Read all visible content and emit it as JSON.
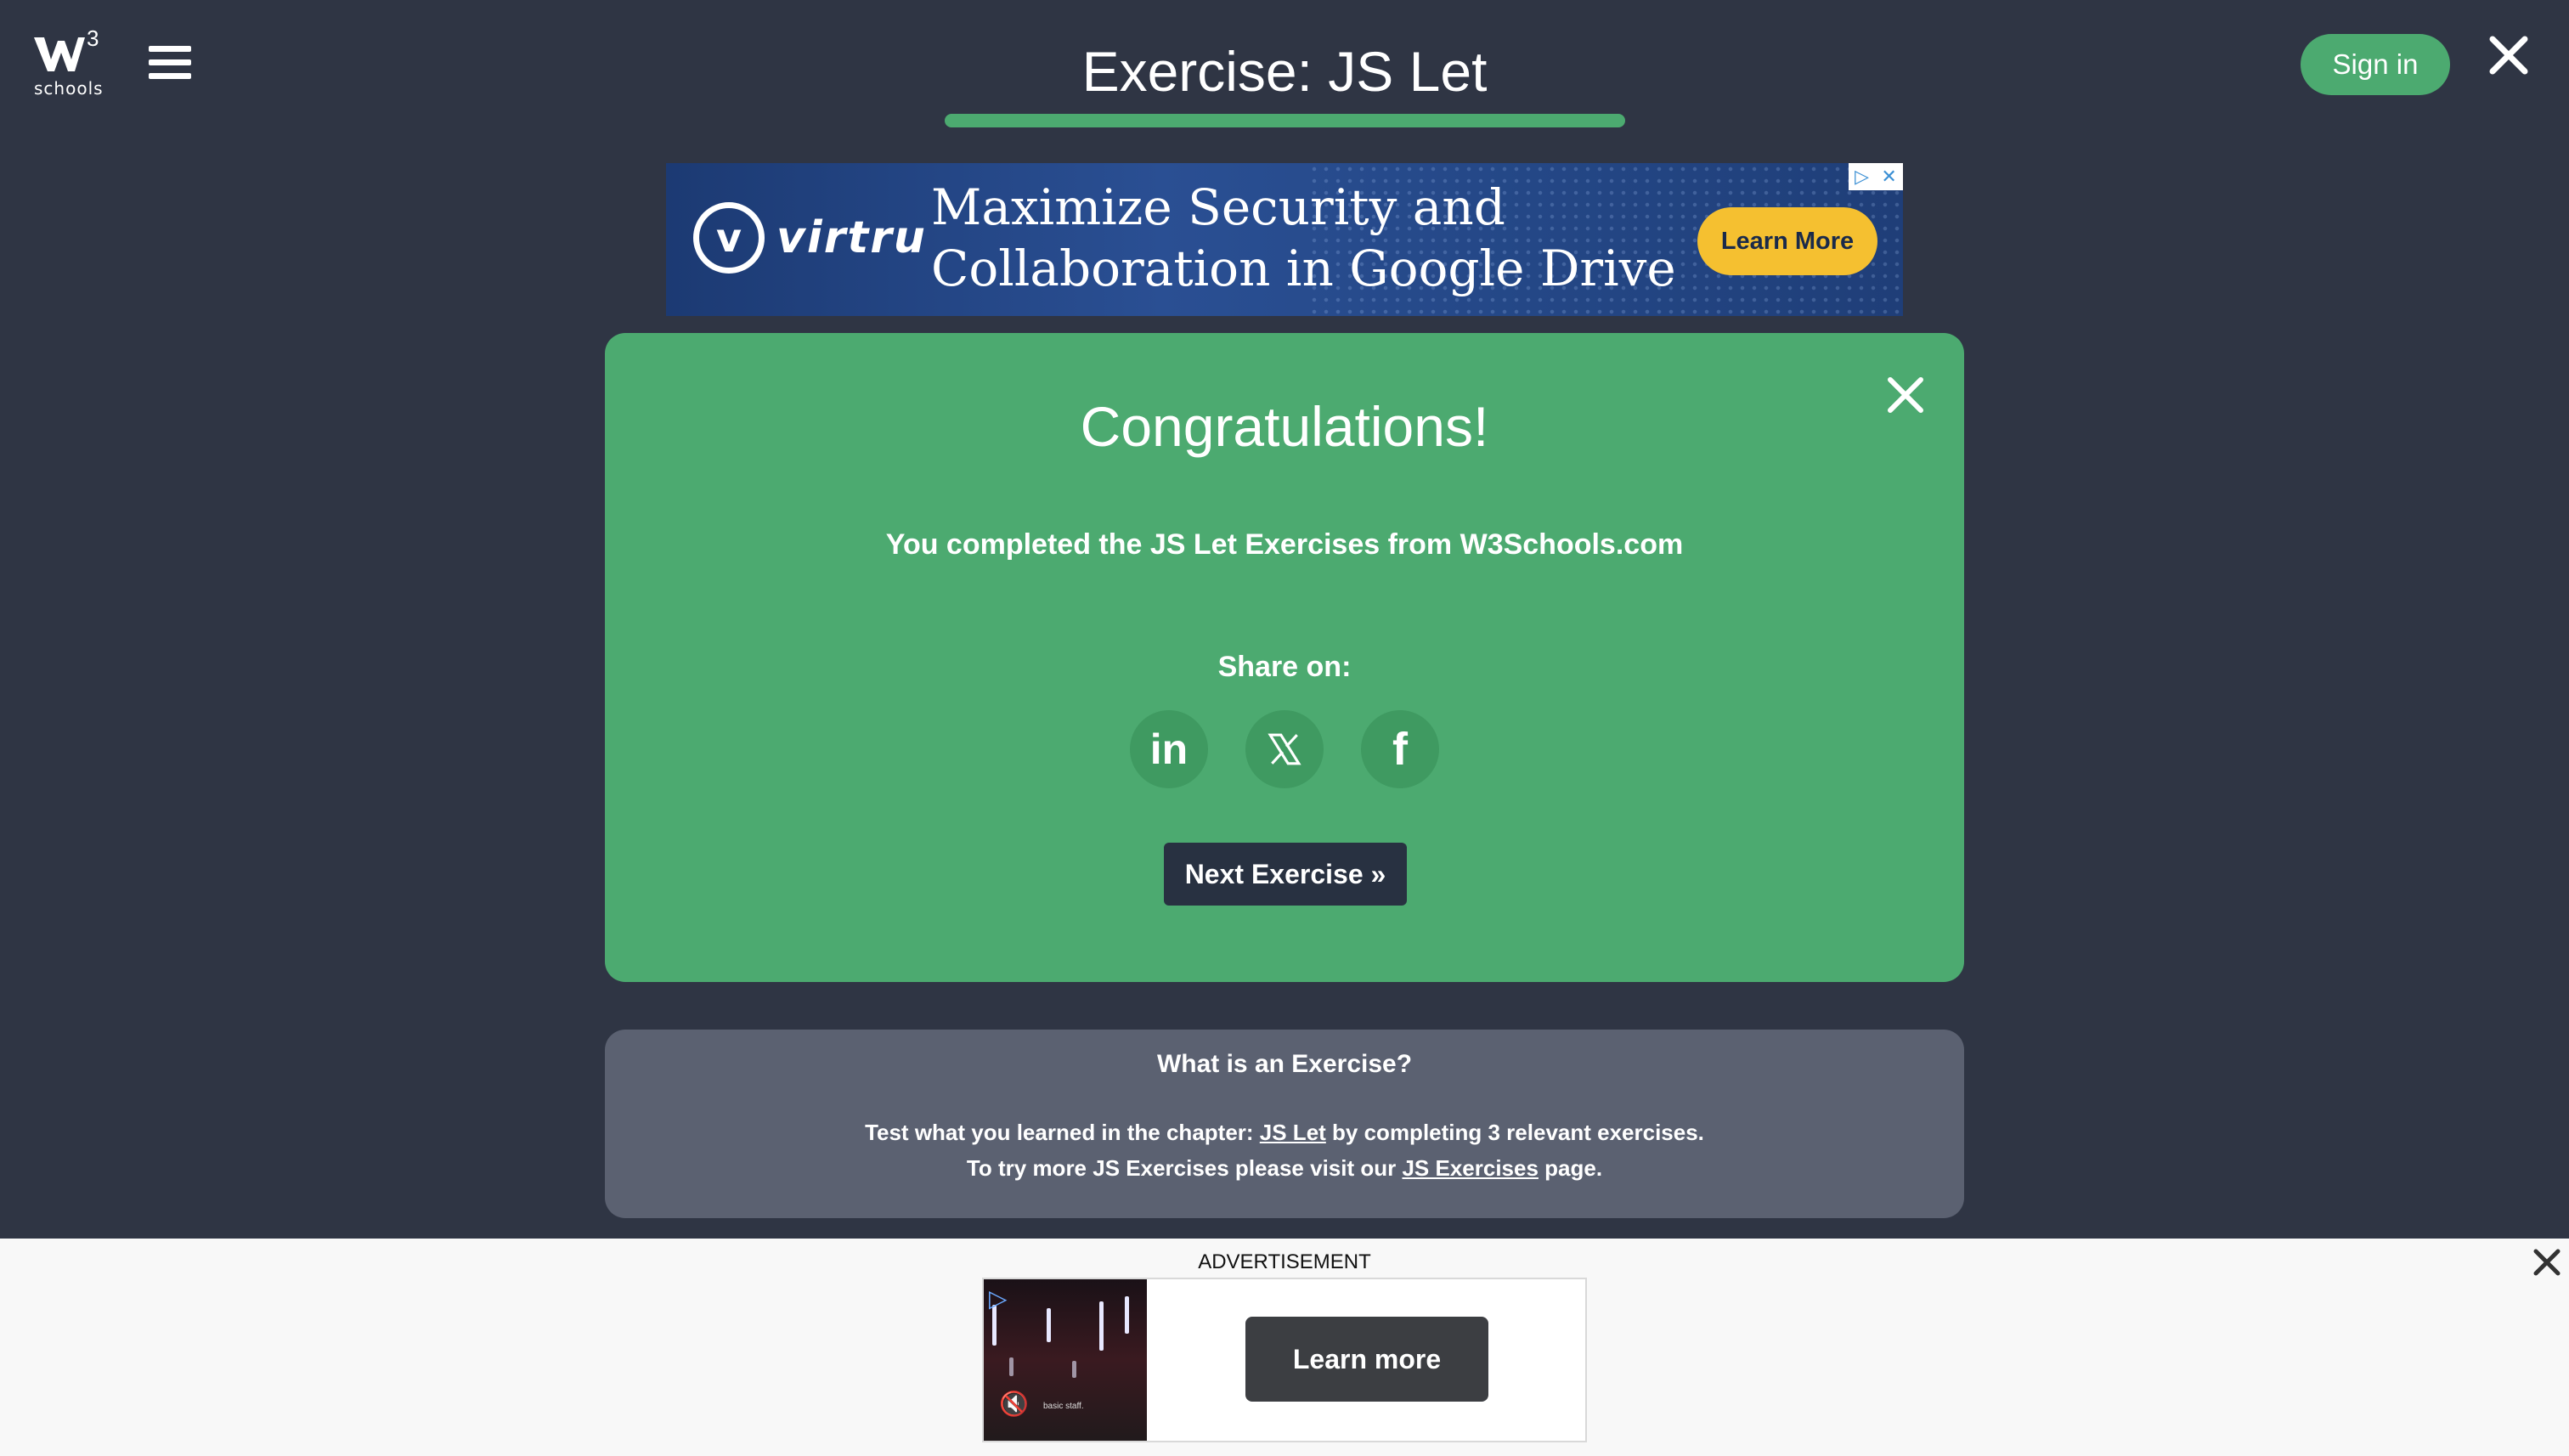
{
  "header": {
    "logo_superscript": "3",
    "logo_text": "schools",
    "title": "Exercise: JS Let",
    "progress_fraction": 1.0,
    "signin_label": "Sign in"
  },
  "top_ad": {
    "brand": "virtru",
    "headline_line1": "Maximize Security and",
    "headline_line2": "Collaboration in Google Drive",
    "cta": "Learn More"
  },
  "congrats": {
    "title": "Congratulations!",
    "message": "You completed the JS Let Exercises from W3Schools.com",
    "share_label": "Share on:",
    "share_linkedin": "in",
    "share_facebook": "f",
    "next_label": "Next Exercise »"
  },
  "info": {
    "title": "What is an Exercise?",
    "line1_pre": "Test what you learned in the chapter: ",
    "line1_link": "JS Let",
    "line1_post": " by completing 3 relevant exercises.",
    "line2_pre": "To try more JS Exercises please visit our ",
    "line2_link": "JS Exercises",
    "line2_post": " page."
  },
  "bottom_ad": {
    "label": "ADVERTISEMENT",
    "video_caption": "basic staff.",
    "cta": "Learn more"
  },
  "colors": {
    "background": "#2f3544",
    "accent_green": "#4caa70",
    "dark_button": "#283141",
    "info_panel": "#5b6171",
    "ad_cta_yellow": "#f5c030"
  },
  "icons": {
    "menu": "hamburger-icon",
    "close": "close-icon",
    "linkedin": "linkedin-icon",
    "x": "x-twitter-icon",
    "facebook": "facebook-icon",
    "adchoices": "adchoices-icon",
    "mute": "mute-icon"
  }
}
